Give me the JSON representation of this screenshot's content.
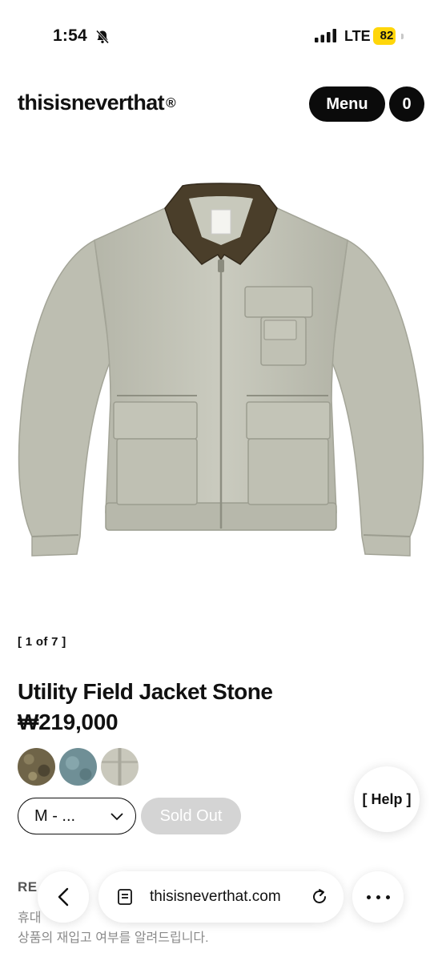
{
  "status_bar": {
    "time": "1:54",
    "network": "LTE",
    "battery": "82",
    "battery_level": 0.82,
    "icons": [
      "bell-slash-icon",
      "signal-icon",
      "battery-icon"
    ]
  },
  "header": {
    "logo": "thisisneverthat",
    "logo_mark": "®",
    "menu_label": "Menu",
    "cart_count": "0"
  },
  "product": {
    "image_counter": "[ 1 of 7 ]",
    "title": "Utility Field Jacket Stone",
    "price": "₩219,000",
    "swatch_colors": [
      "#6f6448",
      "#6f8f96",
      "#c9c8bc"
    ],
    "jacket_color": "#c4c5b8",
    "collar_color": "#4a3e2a",
    "size_value": "M - ...",
    "sold_out_label": "Sold Out"
  },
  "help_label": "[ Help ]",
  "restock": {
    "title": "RE",
    "desc_line1": "휴대",
    "desc_line2": "상품의 재입고 여부를 알려드립니다."
  },
  "browser": {
    "url": "thisisneverthat.com",
    "icons": [
      "back-arrow-icon",
      "page-icon",
      "reload-icon",
      "more-icon"
    ]
  }
}
